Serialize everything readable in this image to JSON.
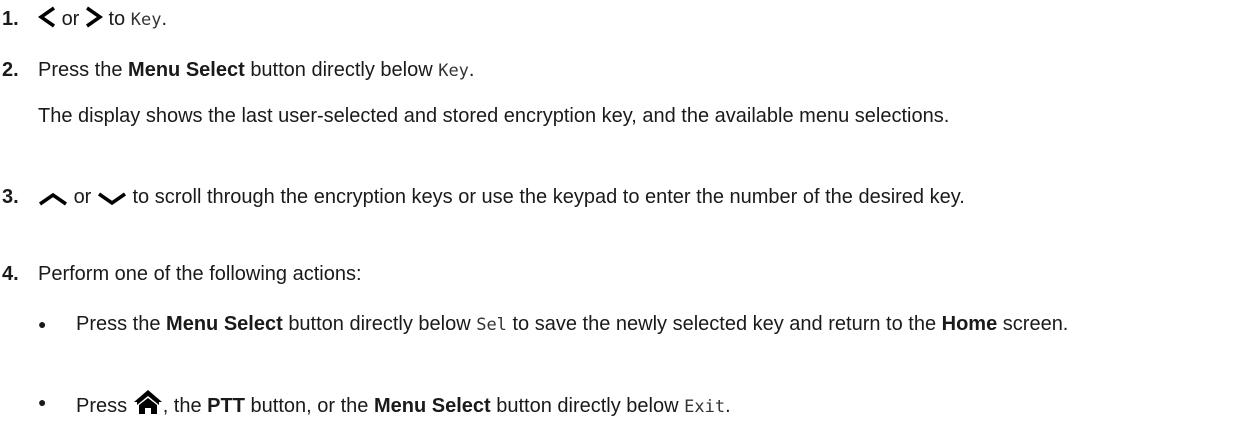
{
  "steps": [
    {
      "num": "1.",
      "or": "or",
      "to": "to",
      "key": "Key",
      "end": "."
    },
    {
      "num": "2.",
      "press": "Press the",
      "menu_select": "Menu Select",
      "below": "button directly below",
      "key": "Key",
      "end": ".",
      "note": "The display shows the last user-selected and stored encryption key, and the available menu selections."
    },
    {
      "num": "3.",
      "or": "or",
      "rest": "to scroll through the encryption keys or use the keypad to enter the number of the desired key."
    },
    {
      "num": "4.",
      "text": "Perform one of the following actions:"
    }
  ],
  "bullets": [
    {
      "press": "Press the",
      "menu_select": "Menu Select",
      "below": "button directly below",
      "sel": "Sel",
      "rest1": "to save the newly selected key and return to the",
      "home": "Home",
      "rest2": "screen."
    },
    {
      "press": "Press",
      "comma_the": ", the",
      "ptt": "PTT",
      "or_the": "button, or the",
      "menu_select": "Menu Select",
      "below": "button directly below",
      "exit": "Exit",
      "end": "."
    }
  ],
  "icons": {
    "left": "left-arrow-icon",
    "right": "right-arrow-icon",
    "up": "up-arrow-icon",
    "down": "down-arrow-icon",
    "home": "home-icon"
  },
  "colors": {
    "text": "#1a1a1a",
    "icon": "#000000"
  }
}
